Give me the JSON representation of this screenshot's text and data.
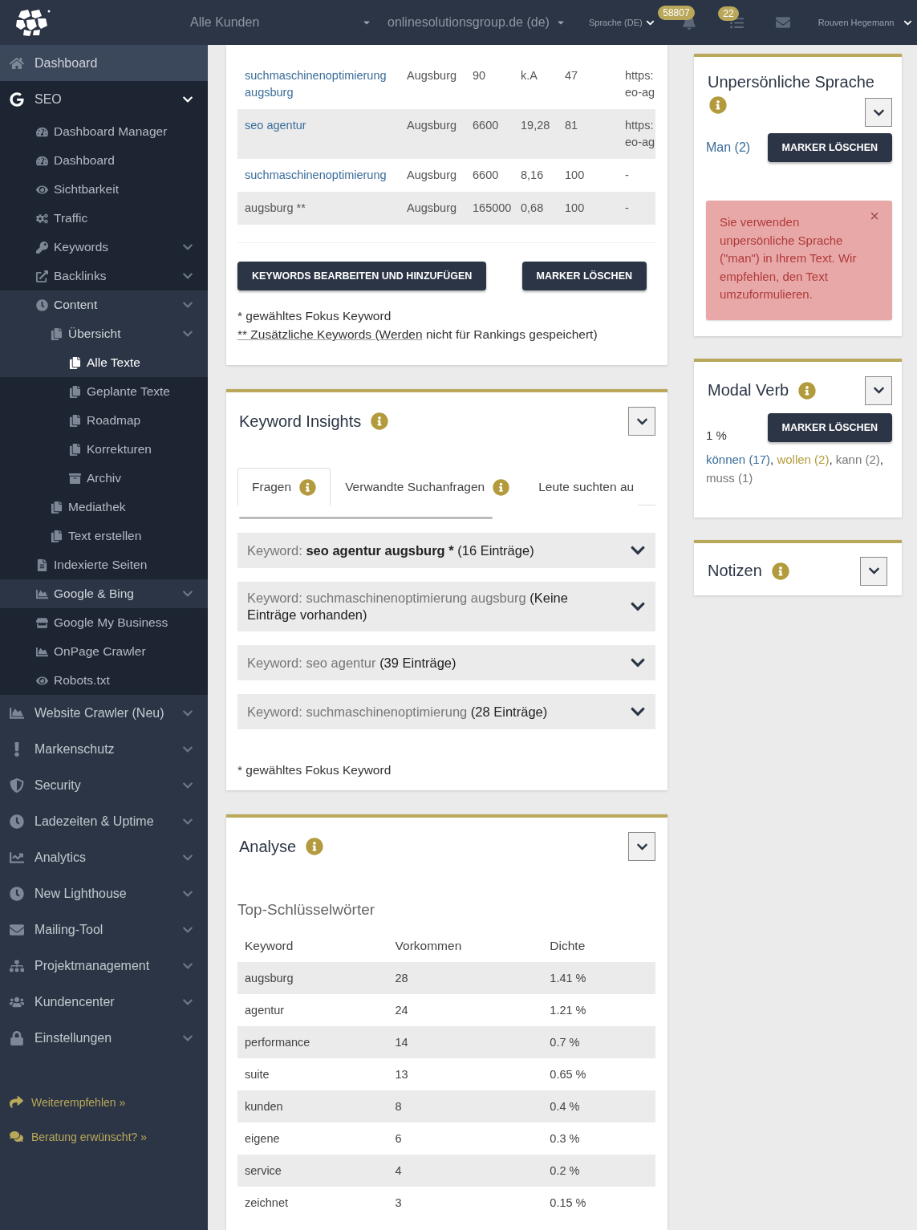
{
  "header": {
    "customer_select": {
      "value": "Alle Kunden"
    },
    "domain_select": {
      "value": "onlinesolutionsgroup.de (de)"
    },
    "language": "Sprache (DE)",
    "notifications": {
      "count": "58807"
    },
    "tasks": {
      "count": "22"
    },
    "user": "Rouven Hegemann"
  },
  "sidebar": {
    "items": [
      {
        "label": "Dashboard",
        "selected": false,
        "highlighted": true
      },
      {
        "label": "SEO",
        "selected": false,
        "highlighted": false,
        "expanded": true,
        "children": [
          {
            "label": "Dashboard Manager",
            "selected": false,
            "highlighted": false
          },
          {
            "label": "Dashboard",
            "selected": false,
            "highlighted": false
          },
          {
            "label": "Sichtbarkeit",
            "selected": false,
            "highlighted": false
          },
          {
            "label": "Traffic",
            "selected": false,
            "highlighted": false
          },
          {
            "label": "Keywords",
            "selected": false,
            "highlighted": false,
            "expanded": false
          },
          {
            "label": "Backlinks",
            "selected": false,
            "highlighted": false,
            "expanded": false
          },
          {
            "label": "Content",
            "selected": false,
            "highlighted": true,
            "expanded": true,
            "children": [
              {
                "label": "Übersicht",
                "selected": false,
                "highlighted": true,
                "expanded": true,
                "children": [
                  {
                    "label": "Alle Texte",
                    "selected": true,
                    "highlighted": true
                  },
                  {
                    "label": "Geplante Texte",
                    "selected": false,
                    "highlighted": false
                  },
                  {
                    "label": "Roadmap",
                    "selected": false,
                    "highlighted": false
                  },
                  {
                    "label": "Korrekturen",
                    "selected": false,
                    "highlighted": false
                  },
                  {
                    "label": "Archiv",
                    "selected": false,
                    "highlighted": false
                  }
                ]
              },
              {
                "label": "Mediathek",
                "selected": false,
                "highlighted": false
              },
              {
                "label": "Text erstellen",
                "selected": false,
                "highlighted": false
              }
            ]
          },
          {
            "label": "Indexierte Seiten",
            "selected": false,
            "highlighted": false
          },
          {
            "label": "Google & Bing",
            "selected": false,
            "highlighted": true,
            "expanded": false
          },
          {
            "label": "Google My Business",
            "selected": false,
            "highlighted": false
          },
          {
            "label": "OnPage Crawler",
            "selected": false,
            "highlighted": false
          },
          {
            "label": "Robots.txt",
            "selected": false,
            "highlighted": false
          }
        ]
      },
      {
        "label": "Website Crawler (Neu)",
        "selected": false,
        "highlighted": false,
        "expanded": false
      },
      {
        "label": "Markenschutz",
        "selected": false,
        "highlighted": false,
        "expanded": false
      },
      {
        "label": "Security",
        "selected": false,
        "highlighted": false,
        "expanded": false
      },
      {
        "label": "Ladezeiten & Uptime",
        "selected": false,
        "highlighted": false,
        "expanded": false
      },
      {
        "label": "Analytics",
        "selected": false,
        "highlighted": false,
        "expanded": false
      },
      {
        "label": "New Lighthouse",
        "selected": false,
        "highlighted": false,
        "expanded": false
      },
      {
        "label": "Mailing-Tool",
        "selected": false,
        "highlighted": false,
        "expanded": false
      },
      {
        "label": "Projektmanagement",
        "selected": false,
        "highlighted": false,
        "expanded": false
      },
      {
        "label": "Kundencenter",
        "selected": false,
        "highlighted": false,
        "expanded": false
      },
      {
        "label": "Einstellungen",
        "selected": false,
        "highlighted": false,
        "expanded": false
      }
    ],
    "footer_links": [
      "Weiterempfehlen »",
      "Beratung erwünscht? »"
    ]
  },
  "keyword_table": {
    "rows": [
      {
        "column_1": "suchmaschinenoptimierung augsburg",
        "link": true,
        "column_2": "Augsburg",
        "column_3": "90",
        "column_4": "k.A",
        "column_5": "47",
        "column_6": "https:\neo-ag"
      },
      {
        "column_1": "seo agentur",
        "link": true,
        "column_2": "Augsburg",
        "column_3": "6600",
        "column_4": "19,28",
        "column_5": "81",
        "column_6": "https:\neo-ag"
      },
      {
        "column_1": "suchmaschinenoptimierung",
        "link": true,
        "column_2": "Augsburg",
        "column_3": "6600",
        "column_4": "8,16",
        "column_5": "100",
        "column_6": "-"
      },
      {
        "column_1": "augsburg **",
        "link": false,
        "column_2": "Augsburg",
        "column_3": "165000",
        "column_4": "0,68",
        "column_5": "100",
        "column_6": "-"
      }
    ],
    "buttons": [
      "KEYWORDS BEARBEITEN UND HINZUFÜGEN",
      "MARKER LÖSCHEN"
    ],
    "notes": [
      {
        "text": "* gewähltes Fokus Keyword"
      },
      {
        "underlined": "** Zusätzliche Keywords (Werden",
        "text": " nicht für Rankings gespeichert)"
      }
    ]
  },
  "keyword_insights": {
    "title": "Keyword Insights",
    "tabs": [
      {
        "label": "Fragen",
        "info": true,
        "selected": true
      },
      {
        "label": "Verwandte Suchanfragen",
        "info": true,
        "selected": false
      },
      {
        "label": "Leute suchten au",
        "info": false,
        "selected": false
      }
    ],
    "keywords": [
      {
        "prefix": "Keyword:",
        "keyword": "seo agentur augsburg *",
        "focus": true,
        "count": "(16 Einträge)"
      },
      {
        "prefix": "Keyword:",
        "keyword": "suchmaschinenoptimierung augsburg",
        "focus": false,
        "count": "(Keine Einträge vorhanden)"
      },
      {
        "prefix": "Keyword:",
        "keyword": "seo agentur",
        "focus": false,
        "count": "(39 Einträge)"
      },
      {
        "prefix": "Keyword:",
        "keyword": "suchmaschinenoptimierung",
        "focus": false,
        "count": "(28 Einträge)"
      }
    ],
    "note": "* gewähltes Fokus Keyword"
  },
  "analyse": {
    "title": "Analyse",
    "subtitle": "Top-Schlüsselwörter",
    "columns": [
      "Keyword",
      "Vorkommen",
      "Dichte"
    ],
    "rows": [
      [
        "augsburg",
        "28",
        "1.41 %"
      ],
      [
        "agentur",
        "24",
        "1.21 %"
      ],
      [
        "performance",
        "14",
        "0.7 %"
      ],
      [
        "suite",
        "13",
        "0.65 %"
      ],
      [
        "kunden",
        "8",
        "0.4 %"
      ],
      [
        "eigene",
        "6",
        "0.3 %"
      ],
      [
        "service",
        "4",
        "0.2 %"
      ],
      [
        "zeichnet",
        "3",
        "0.15 %"
      ]
    ]
  },
  "impersonal_language": {
    "title": "Unpersönliche Sprache",
    "finding": "Man (2)",
    "button": "MARKER LÖSCHEN",
    "alert": {
      "text": "Sie verwenden unpersönliche Sprache (\"man\") in Ihrem Text. Wir empfehlen, den Text umzuformulieren.",
      "close": "×"
    }
  },
  "modal_verb": {
    "title": "Modal Verb",
    "percentage": "1 %",
    "button": "MARKER LÖSCHEN",
    "verbs": [
      {
        "text": "können (17)",
        "color": "#3a6d9a",
        "separator": ","
      },
      {
        "text": "wollen (2)",
        "color": "#b39b3d",
        "separator": ","
      },
      {
        "text": "kann (2)",
        "color": "#777777",
        "separator": ","
      },
      {
        "text": "muss (1)",
        "color": "#777777"
      }
    ]
  },
  "notes": {
    "title": "Notizen"
  }
}
